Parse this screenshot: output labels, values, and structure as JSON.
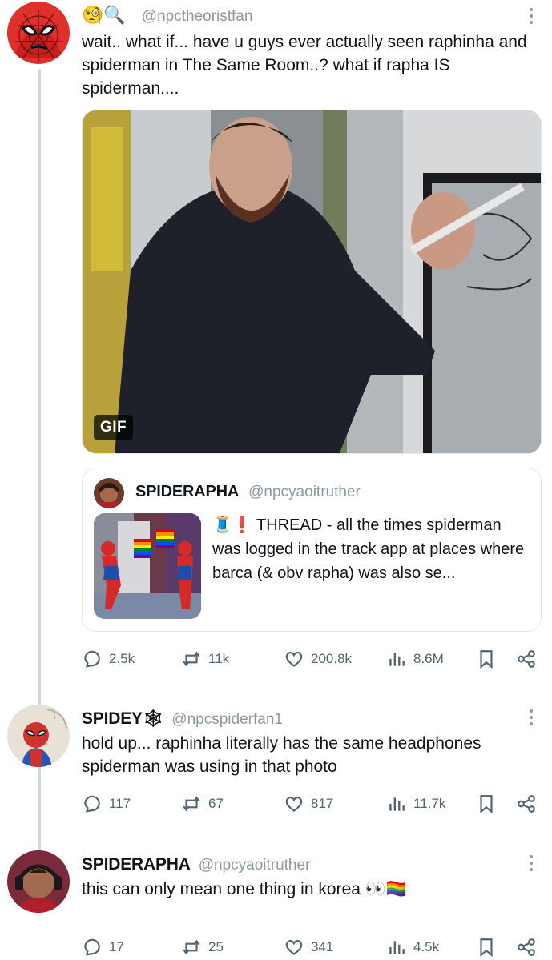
{
  "posts": [
    {
      "emoji_prefix": "🧐🔍",
      "display_name": "",
      "handle": "@npctheoristfan",
      "text": "wait.. what if... have u guys ever actually seen raphinha and spiderman in The Same Room..? what if rapha IS spiderman....",
      "media": {
        "badge": "GIF"
      },
      "quote": {
        "display_name": "SPIDERAPHA",
        "handle": "@npcyaoitruther",
        "text": "🧵❗ THREAD - all the times spiderman was logged in the track app at places where barca (& obv rapha) was also se..."
      },
      "actions": {
        "replies": "2.5k",
        "reposts": "11k",
        "likes": "200.8k",
        "views": "8.6M"
      }
    },
    {
      "display_name": "SPIDEY🕸",
      "handle": "@npcspiderfan1",
      "text": "hold up... raphinha literally has the same headphones spiderman was using in that photo",
      "actions": {
        "replies": "117",
        "reposts": "67",
        "likes": "817",
        "views": "11.7k"
      }
    },
    {
      "display_name": "SPIDERAPHA",
      "handle": "@npcyaoitruther",
      "text": "this can only mean one thing in korea 👀🏳️‍🌈",
      "actions": {
        "replies": "17",
        "reposts": "25",
        "likes": "341",
        "views": "4.5k"
      }
    }
  ],
  "icons": {
    "reply": "speech-bubble-icon",
    "repost": "repost-arrows-icon",
    "like": "heart-icon",
    "views": "bar-chart-icon",
    "bookmark": "bookmark-icon",
    "share": "share-icon",
    "more": "vertical-dots-icon"
  },
  "colors": {
    "muted": "#536471",
    "handle": "#8b98a5",
    "thread_line": "#cfd9de",
    "border": "#e1e8ed"
  }
}
